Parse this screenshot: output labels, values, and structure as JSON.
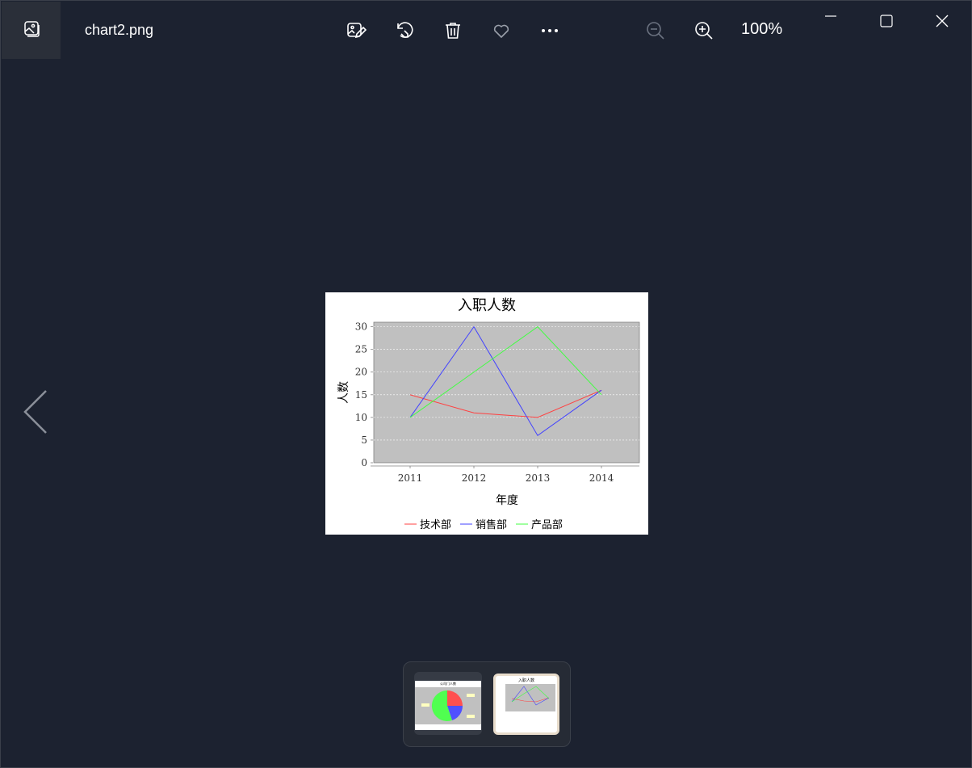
{
  "window": {
    "filename": "chart2.png",
    "zoom_level": "100%",
    "toolbar_icons": [
      "edit-image-icon",
      "rotate-icon",
      "delete-icon",
      "favorite-icon",
      "more-icon",
      "zoom-out-icon",
      "zoom-in-icon"
    ],
    "window_controls": [
      "minimize-icon",
      "maximize-icon",
      "close-icon"
    ]
  },
  "colors": {
    "background": "#1c2230",
    "plot_bg": "#c0c0c0",
    "series_tech": "#ff4040",
    "series_sales": "#4040ff",
    "series_product": "#40ff40"
  },
  "chart_data": {
    "type": "line",
    "title": "入职人数",
    "xlabel": "年度",
    "ylabel": "人数",
    "categories": [
      "2011",
      "2012",
      "2013",
      "2014"
    ],
    "ylim": [
      0,
      31
    ],
    "yticks": [
      0,
      5,
      10,
      15,
      20,
      25,
      30
    ],
    "grid": true,
    "legend_position": "bottom",
    "series": [
      {
        "name": "技术部",
        "values": [
          15,
          11,
          10,
          16
        ]
      },
      {
        "name": "销售部",
        "values": [
          10,
          30,
          6,
          16
        ]
      },
      {
        "name": "产品部",
        "values": [
          10,
          20,
          30,
          15
        ]
      }
    ]
  },
  "filmstrip": {
    "thumbnails": [
      {
        "selected": false,
        "title": "公司门人数"
      },
      {
        "selected": true,
        "title": "入职人数"
      }
    ]
  }
}
